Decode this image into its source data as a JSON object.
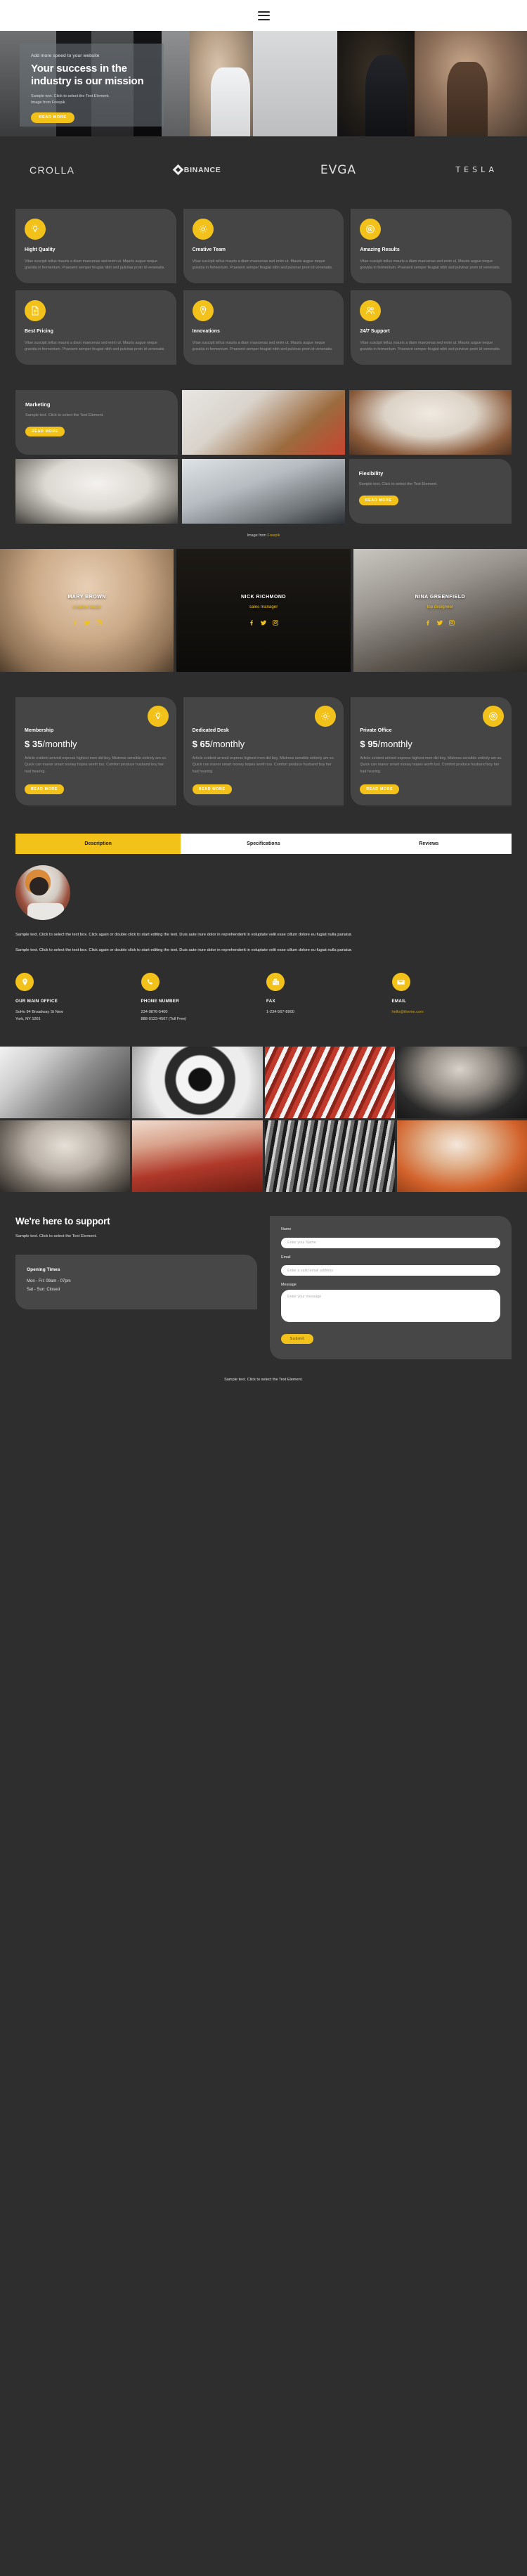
{
  "topbar": {
    "menu_icon": "hamburger-menu-icon"
  },
  "hero": {
    "kicker": "Add more speed to your website",
    "title": "Your success in the industry is our mission",
    "subtitle_line1": "Sample text. Click to select the Text Element.",
    "subtitle_line2": "Image from Freepik",
    "button_label": "READ MORE"
  },
  "logos": [
    {
      "name": "CROLLA",
      "icon": "crolla-logo"
    },
    {
      "name": "BINANCE",
      "icon": "binance-logo"
    },
    {
      "name": "EVGA",
      "icon": "evga-logo"
    },
    {
      "name": "TESLA",
      "icon": "tesla-logo"
    }
  ],
  "features": [
    {
      "icon": "lightbulb-icon",
      "title": "Hight Quality",
      "text": "Vitae suscipit tellus mauris a diam maecenas sed enim ut. Mauris augue neque gravida in fermentum. Praesent semper feugiat nibh sed pulvinar proin id venenatis."
    },
    {
      "icon": "gear-icon",
      "title": "Creative Team",
      "text": "Vitae suscipit tellus mauris a diam maecenas sed enim ut. Mauris augue neque gravida in fermentum. Praesent semper feugiat nibh sed pulvinar proin id venenatis."
    },
    {
      "icon": "target-icon",
      "title": "Amazing Results",
      "text": "Vitae suscipit tellus mauris a diam maecenas sed enim ut. Mauris augue neque gravida in fermentum. Praesent semper feugiat nibh sed pulvinar proin id venenatis."
    },
    {
      "icon": "document-checklist-icon",
      "title": "Best Pricing",
      "text": "Vitae suscipit tellus mauris a diam maecenas sed enim ut. Mauris augue neque gravida in fermentum. Praesent semper feugiat nibh sed pulvinar proin id venenatis."
    },
    {
      "icon": "map-pin-icon",
      "title": "Innovations",
      "text": "Vitae suscipit tellus mauris a diam maecenas sed enim ut. Mauris augue neque gravida in fermentum. Praesent semper feugiat nibh sed pulvinar proin id venenatis."
    },
    {
      "icon": "users-icon",
      "title": "24/7 Support",
      "text": "Vitae suscipit tellus mauris a diam maecenas sed enim ut. Mauris augue neque gravida in fermentum. Praesent semper feugiat nibh sed pulvinar proin id venenatis."
    }
  ],
  "mosaic": {
    "marketing": {
      "title": "Marketing",
      "text": "Sample text. Click to select the Text Element.",
      "button_label": "READ MORE"
    },
    "flexibility": {
      "title": "Flexibility",
      "text": "Sample text. Click to select the Text Element.",
      "button_label": "READ MORE"
    },
    "credit_prefix": "Image from ",
    "credit_link": "Freepik"
  },
  "team": [
    {
      "name": "MARY BROWN",
      "role": "creative leader"
    },
    {
      "name": "NICK RICHMOND",
      "role": "sales manager"
    },
    {
      "name": "NINA GREENFIELD",
      "role": "top designeer"
    }
  ],
  "pricing": [
    {
      "icon": "lightbulb-icon",
      "name": "Membership",
      "currency": "$",
      "amount": "35",
      "period": "/monthly",
      "text": "Article evident arrived express highest men did boy. Mistress sensible entirely am so. Quick can manor smart money hopes worth too. Comfort produce husband boy her had hearing.",
      "button_label": "READ MORE"
    },
    {
      "icon": "gear-icon",
      "name": "Dedicated Desk",
      "currency": "$",
      "amount": "65",
      "period": "/monthly",
      "text": "Article evident arrived express highest men did boy. Mistress sensible entirely am so. Quick can manor smart money hopes worth too. Comfort produce husband boy her had hearing.",
      "button_label": "READ MORE"
    },
    {
      "icon": "target-icon",
      "name": "Private Office",
      "currency": "$",
      "amount": "95",
      "period": "/monthly",
      "text": "Article evident arrived express highest men did boy. Mistress sensible entirely am so. Quick can manor smart money hopes worth too. Comfort produce husband boy her had hearing.",
      "button_label": "READ MORE"
    }
  ],
  "tabs": {
    "items": [
      {
        "label": "Description",
        "active": true
      },
      {
        "label": "Specifications",
        "active": false
      },
      {
        "label": "Reviews",
        "active": false
      }
    ],
    "paragraph1": "Sample text. Click to select the text box. Click again or double click to start editing the text. Duis aute irure dolor in reprehenderit in voluptate velit esse cillum dolore eu fugiat nulla pariatur.",
    "paragraph2": "Sample text. Click to select the text box. Click again or double click to start editing the text. Duis aute irure dolor in reprehenderit in voluptate velit esse cillum dolore eu fugiat nulla pariatur."
  },
  "contacts": [
    {
      "icon": "location-pin-icon",
      "label": "OUR MAIN OFFICE",
      "value": "SoHo 94 Broadway St New\nYork, NY 1001",
      "is_link": false
    },
    {
      "icon": "phone-icon",
      "label": "PHONE NUMBER",
      "value": "234-9876-5400\n888-0123-4567 (Toll Free)",
      "is_link": false
    },
    {
      "icon": "fax-icon",
      "label": "FAX",
      "value": "1-234-567-8900",
      "is_link": false
    },
    {
      "icon": "envelope-icon",
      "label": "EMAIL",
      "value": "hello@theme.com",
      "is_link": true
    }
  ],
  "support": {
    "title": "We're here to support",
    "subtitle": "Sample text. Click to select the Text Element.",
    "hours_title": "Opening Times",
    "hours_line1": "Mon - Fri: 09am - 07pm",
    "hours_line2": "Sat - Sun: Closed",
    "form": {
      "name_label": "Name",
      "name_placeholder": "Enter your Name",
      "email_label": "Email",
      "email_placeholder": "Enter a valid email address",
      "message_label": "Message",
      "message_placeholder": "Enter your message",
      "submit_label": "Submit"
    }
  },
  "footer": {
    "text": "Sample text. Click to select the Text Element."
  },
  "colors": {
    "accent": "#f2c21a",
    "background": "#2e2e2e",
    "card": "#454545",
    "link": "#c9a227"
  }
}
